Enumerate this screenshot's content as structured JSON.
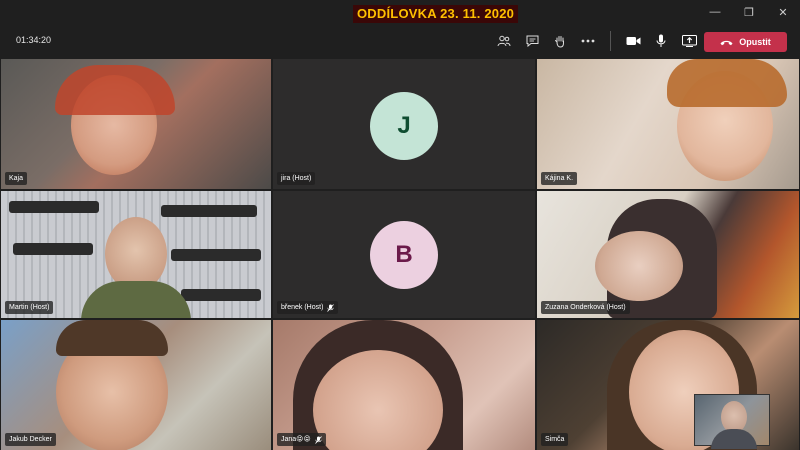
{
  "window": {
    "title": "ODDÍLOVKA 23. 11. 2020",
    "minimize_label": "—",
    "maximize_label": "❐",
    "close_label": "✕"
  },
  "toolbar": {
    "timer": "01:34:20",
    "leave_label": "Opustit",
    "leave_color": "#c4314b"
  },
  "participants": [
    {
      "name": "Kaja",
      "video": true
    },
    {
      "name": "jira (Host)",
      "video": false,
      "initial": "J",
      "avatar_bg": "#c4e4d6",
      "avatar_fg": "#0f4d31"
    },
    {
      "name": "Kájina K.",
      "video": true
    },
    {
      "name": "Martin (Host)",
      "video": true
    },
    {
      "name": "břenek (Host)",
      "video": false,
      "initial": "B",
      "avatar_bg": "#ecd0e0",
      "avatar_fg": "#6b1a4a",
      "muted": true
    },
    {
      "name": "Zuzana Onderková (Host)",
      "video": true
    },
    {
      "name": "Jakub Decker",
      "video": true
    },
    {
      "name": "Jana😝😝",
      "video": true,
      "muted": true
    },
    {
      "name": "Simča",
      "video": true
    }
  ]
}
